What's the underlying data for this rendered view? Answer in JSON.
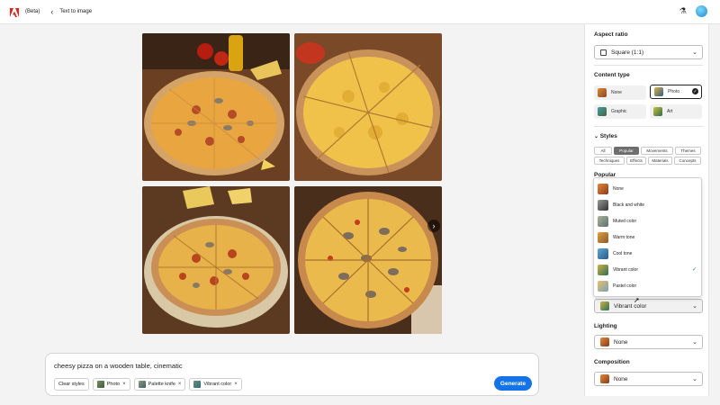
{
  "app": {
    "beta_label": "(Beta)",
    "breadcrumb": "Text to image"
  },
  "colors": {
    "accent": "#1473e6",
    "logo": "#e1251b"
  },
  "icons": {
    "back": "chevron-left-icon",
    "labs": "flask-icon",
    "next": "chevron-right-icon"
  },
  "prompt": {
    "text": "cheesy pizza on a wooden table, cinematic",
    "clear_styles": "Clear styles",
    "chips": [
      "Photo",
      "Palette knife",
      "Vibrant color"
    ],
    "generate": "Generate"
  },
  "panel": {
    "aspect_ratio": {
      "title": "Aspect ratio",
      "value": "Square (1:1)"
    },
    "content_type": {
      "title": "Content type",
      "options": [
        "None",
        "Photo",
        "Graphic",
        "Art"
      ],
      "selected": "Photo"
    },
    "styles": {
      "title": "Styles",
      "tabs": [
        "All",
        "Popular",
        "Movements",
        "Themes",
        "Techniques",
        "Effects",
        "Materials",
        "Concepts"
      ],
      "active_tab": "Popular",
      "popular_label": "Popular",
      "popular_options": [
        "None",
        "Black and white",
        "Muted color",
        "Warm tone",
        "Cool tone",
        "Vibrant color",
        "Pastel color"
      ],
      "selected": "Vibrant color",
      "select_value": "Vibrant color"
    },
    "lighting": {
      "title": "Lighting",
      "value": "None"
    },
    "composition": {
      "title": "Composition",
      "value": "None"
    }
  }
}
